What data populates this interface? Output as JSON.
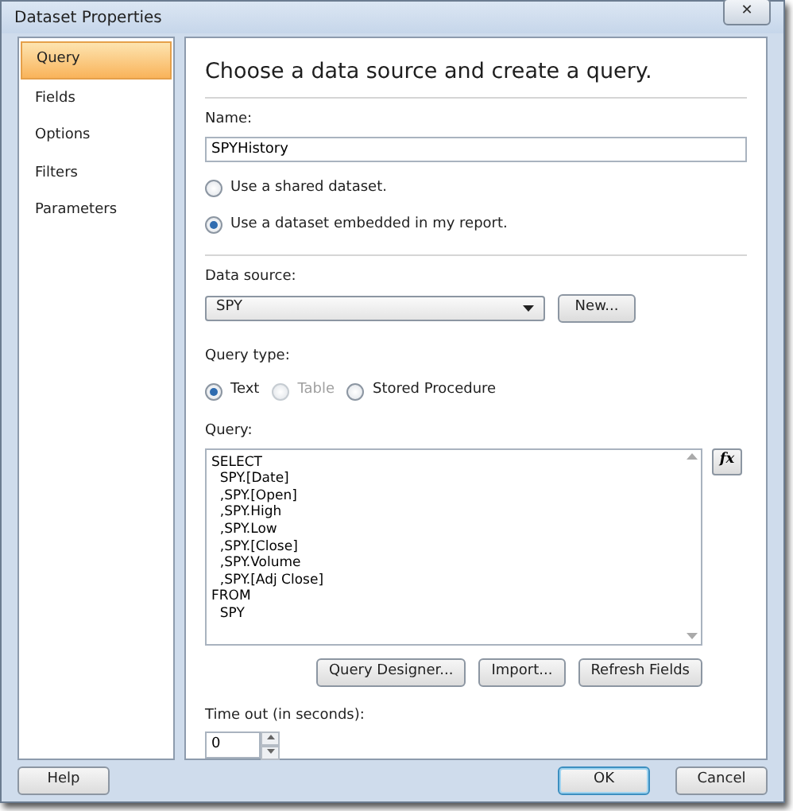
{
  "window": {
    "title": "Dataset Properties",
    "close": "✕"
  },
  "sidebar": {
    "items": [
      {
        "label": "Query",
        "selected": true
      },
      {
        "label": "Fields",
        "selected": false
      },
      {
        "label": "Options",
        "selected": false
      },
      {
        "label": "Filters",
        "selected": false
      },
      {
        "label": "Parameters",
        "selected": false
      }
    ]
  },
  "panel": {
    "heading": "Choose a data source and create a query.",
    "name_label": "Name:",
    "name_value": "SPYHistory",
    "dataset_options": [
      {
        "label": "Use a shared dataset.",
        "selected": false
      },
      {
        "label": "Use a dataset embedded in my report.",
        "selected": true
      }
    ],
    "data_source_label": "Data source:",
    "data_source_value": "SPY",
    "new_button": "New...",
    "query_type_label": "Query type:",
    "query_types": [
      {
        "label": "Text",
        "selected": true,
        "disabled": false
      },
      {
        "label": "Table",
        "selected": false,
        "disabled": true
      },
      {
        "label": "Stored Procedure",
        "selected": false,
        "disabled": false
      }
    ],
    "query_label": "Query:",
    "query_lines": [
      "SELECT",
      "  SPY.[Date]",
      "  ,SPY.[Open]",
      "  ,SPY.High",
      "  ,SPY.Low",
      "  ,SPY.[Close]",
      "  ,SPY.Volume",
      "  ,SPY.[Adj Close]",
      "FROM",
      "  SPY"
    ],
    "fx_button": "fx",
    "query_buttons": [
      "Query Designer...",
      "Import...",
      "Refresh Fields"
    ],
    "timeout_label": "Time out (in seconds):",
    "timeout_value": "0"
  },
  "footer": {
    "help": "Help",
    "ok": "OK",
    "cancel": "Cancel"
  }
}
